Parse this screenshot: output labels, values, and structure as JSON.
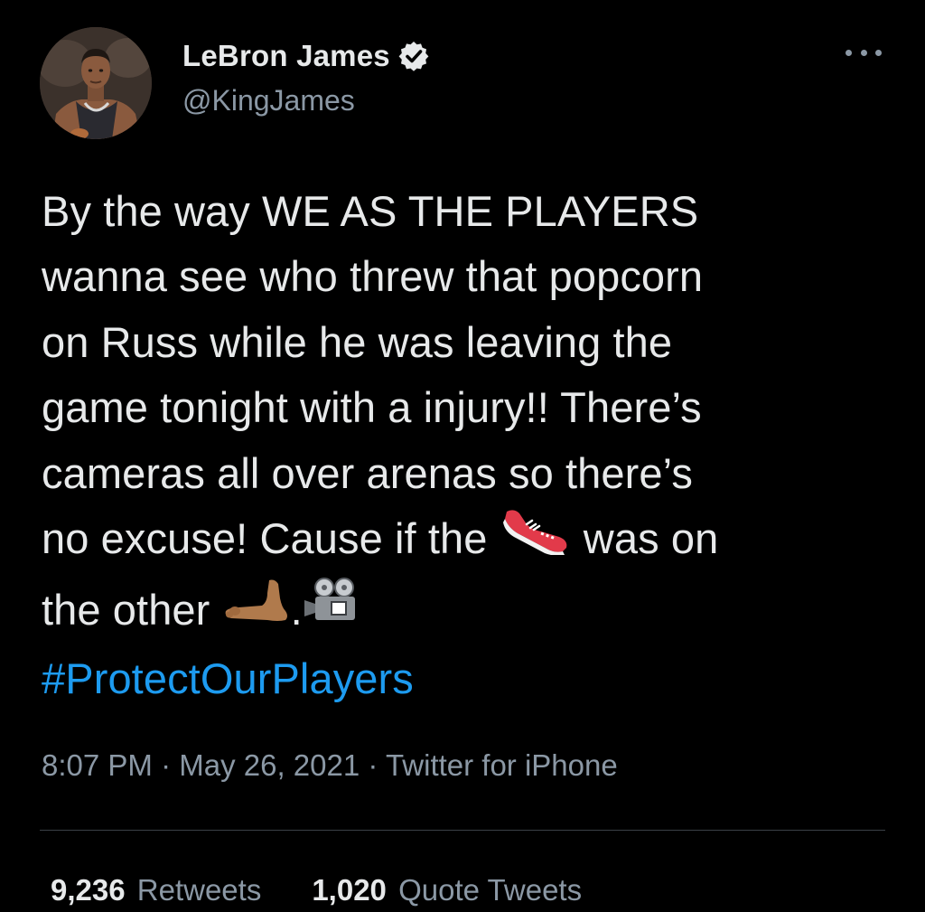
{
  "author": {
    "display_name": "LeBron James",
    "handle": "@KingJames",
    "verified": true,
    "avatar": "profile-photo-basketball-player"
  },
  "tweet": {
    "lines": [
      "By the way WE AS THE PLAYERS",
      "wanna see who threw that popcorn",
      "on Russ while he was leaving the",
      "game tonight with a injury!! There’s",
      "cameras all over arenas so there’s"
    ],
    "line6_before": "no excuse! Cause if the ",
    "line6_after": " was on",
    "line7_before": "the other ",
    "line7_after": ".",
    "emojis": [
      "running-shoe-emoji",
      "foot-emoji",
      "movie-camera-emoji"
    ],
    "hashtag": "#ProtectOurPlayers"
  },
  "meta": {
    "time": "8:07 PM",
    "sep": " · ",
    "date": "May 26, 2021",
    "source": "Twitter for iPhone"
  },
  "stats": {
    "retweets_count": "9,236",
    "retweets_label": "Retweets",
    "quotes_count": "1,020",
    "quotes_label": "Quote Tweets"
  },
  "colors": {
    "background": "#000000",
    "text": "#e7e9ea",
    "secondary": "#8b98a5",
    "link": "#1d9bf0"
  }
}
